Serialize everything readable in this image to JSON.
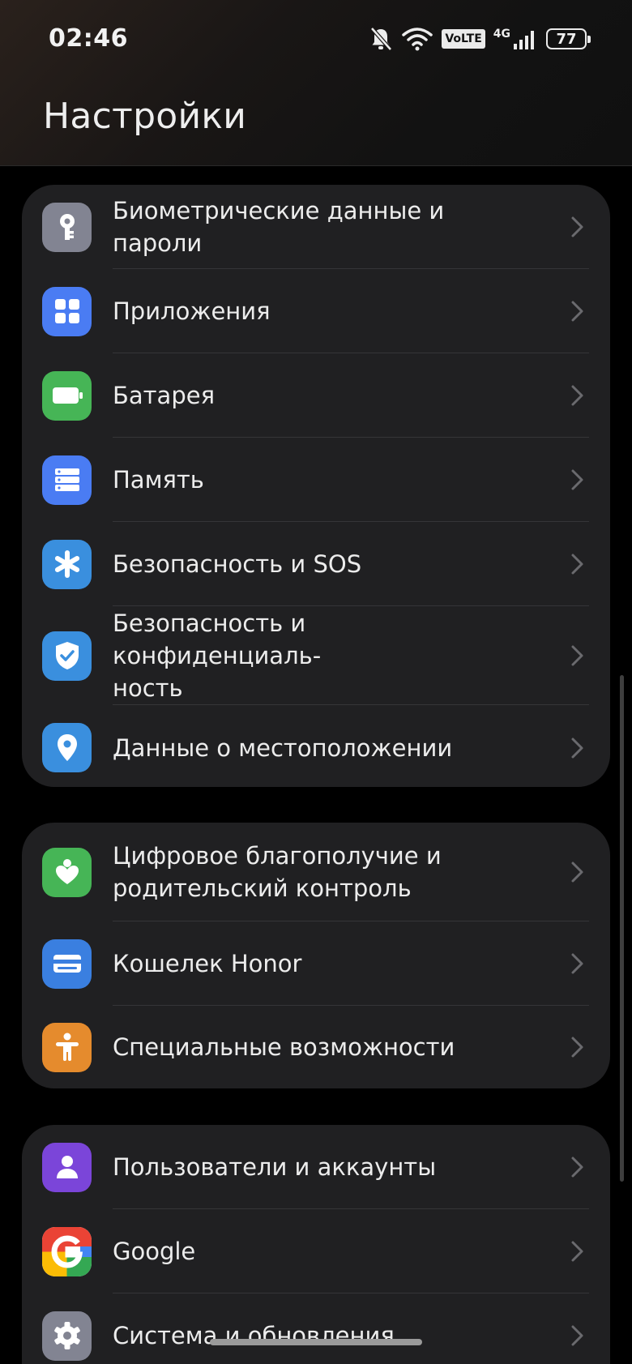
{
  "status_bar": {
    "time": "02:46",
    "volte_label": "VoLTE",
    "network_label": "4G",
    "battery_level": "77",
    "icons": [
      "bell-off-icon",
      "wifi-icon",
      "volte-icon",
      "signal-4g-icon",
      "battery-icon"
    ]
  },
  "page": {
    "title": "Настройки"
  },
  "groups": [
    {
      "items": [
        {
          "label": "Биометрические данные и пароли",
          "icon": "key-icon",
          "color": "#828492"
        },
        {
          "label": "Приложения",
          "icon": "apps-grid-icon",
          "color": "#4a7cf3"
        },
        {
          "label": "Батарея",
          "icon": "battery-icon",
          "color": "#46b556"
        },
        {
          "label": "Память",
          "icon": "storage-icon",
          "color": "#4a7cf3"
        },
        {
          "label": "Безопасность и SOS",
          "icon": "asterisk-icon",
          "color": "#3a8fde"
        },
        {
          "label": "Безопасность и конфиденциаль-\nность",
          "icon": "shield-check-icon",
          "color": "#3a8fde"
        },
        {
          "label": "Данные о местоположении",
          "icon": "location-pin-icon",
          "color": "#3a8fde"
        }
      ]
    },
    {
      "items": [
        {
          "label": "Цифровое благополучие и\nродительский контроль",
          "icon": "wellbeing-heart-icon",
          "color": "#46b556"
        },
        {
          "label": "Кошелек Honor",
          "icon": "wallet-icon",
          "color": "#3a7fe0"
        },
        {
          "label": "Специальные возможности",
          "icon": "accessibility-icon",
          "color": "#e58b2d"
        }
      ]
    },
    {
      "items": [
        {
          "label": "Пользователи и аккаунты",
          "icon": "user-icon",
          "color": "#7b45d9"
        },
        {
          "label": "Google",
          "icon": "google-icon",
          "color": "#ffffff"
        },
        {
          "label": "Система и обновления",
          "icon": "gear-icon",
          "color": "#828492"
        }
      ]
    }
  ]
}
